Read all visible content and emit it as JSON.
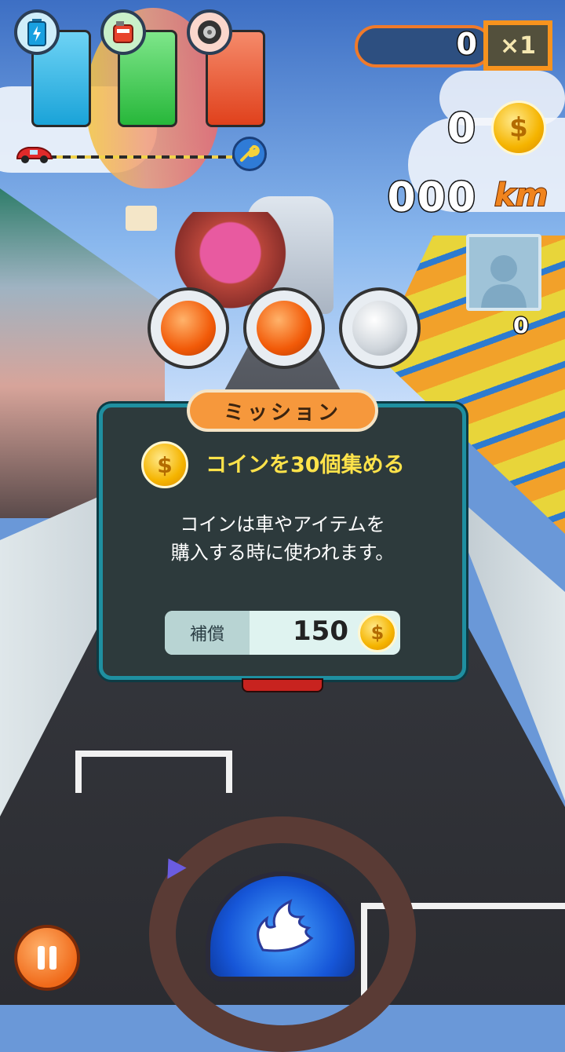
{
  "hud": {
    "score": "0",
    "multiplier": "×1",
    "coins": "0",
    "distance": "000",
    "distance_unit": "km",
    "rival_count": "0",
    "gauges": [
      {
        "icon": "battery-icon",
        "color": "#1aa3d8"
      },
      {
        "icon": "fuel-can-icon",
        "color": "#27b73a"
      },
      {
        "icon": "tire-icon",
        "color": "#e0411c"
      }
    ],
    "progress": 0
  },
  "mission": {
    "title": "ミッション",
    "goal": "コインを30個集める",
    "description_line1": "コインは車やアイテムを",
    "description_line2": "購入する時に使われます。",
    "reward_label": "補償",
    "reward_value": "150"
  },
  "colors": {
    "panel_bg": "#2d3a3c",
    "panel_border": "#1f8fa0",
    "title_bg": "#f6983c",
    "goal_text": "#ffe34a"
  }
}
